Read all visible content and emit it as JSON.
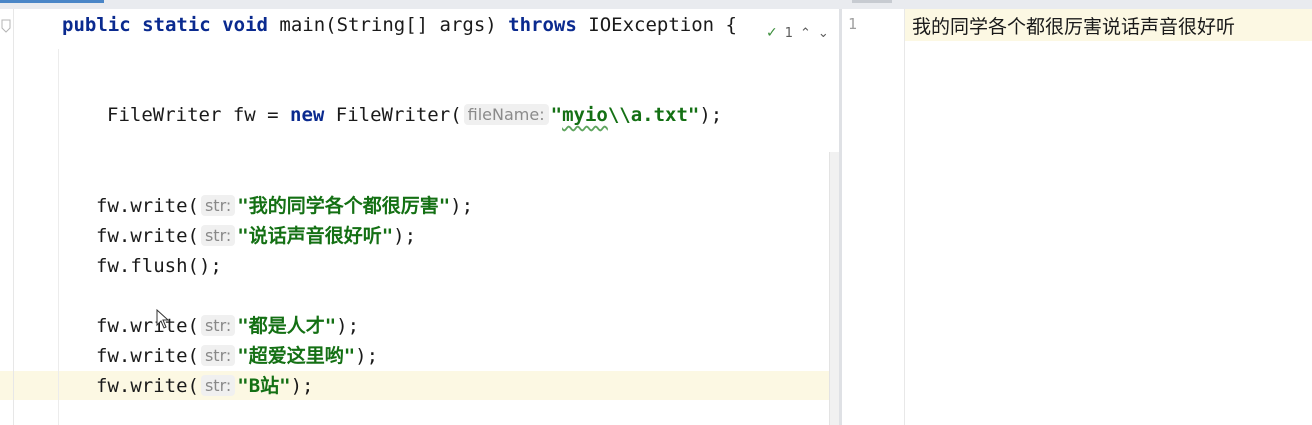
{
  "editor": {
    "inspection": {
      "check_icon": "check-icon",
      "warnings_count": "1",
      "prev_icon": "chevron-up-icon",
      "next_icon": "chevron-down-icon"
    },
    "lines": [
      {
        "parts": [
          {
            "t": "kw",
            "v": "public"
          },
          {
            "t": "plain",
            "v": " "
          },
          {
            "t": "kw",
            "v": "static"
          },
          {
            "t": "plain",
            "v": " "
          },
          {
            "t": "kw",
            "v": "void"
          },
          {
            "t": "plain",
            "v": " main(String[] args) "
          },
          {
            "t": "kw",
            "v": "throws"
          },
          {
            "t": "plain",
            "v": " IOException {"
          }
        ]
      },
      {
        "parts": [
          {
            "t": "plain",
            "v": "FileWriter fw = "
          },
          {
            "t": "kw",
            "v": "new"
          },
          {
            "t": "plain",
            "v": " FileWriter("
          },
          {
            "t": "hint",
            "v": "fileName:"
          },
          {
            "t": "str",
            "v": "\"myio\\\\a.txt\""
          },
          {
            "t": "plain",
            "v": ");"
          }
        ]
      },
      {
        "parts": [
          {
            "t": "plain",
            "v": "fw.write("
          },
          {
            "t": "hint",
            "v": "str:"
          },
          {
            "t": "str",
            "v": "\"我的同学各个都很厉害\""
          },
          {
            "t": "plain",
            "v": ");"
          }
        ]
      },
      {
        "parts": [
          {
            "t": "plain",
            "v": "fw.write("
          },
          {
            "t": "hint",
            "v": "str:"
          },
          {
            "t": "str",
            "v": "\"说话声音很好听\""
          },
          {
            "t": "plain",
            "v": ");"
          }
        ]
      },
      {
        "parts": [
          {
            "t": "plain",
            "v": "fw.flush();"
          }
        ]
      },
      {
        "parts": [
          {
            "t": "plain",
            "v": "fw.write("
          },
          {
            "t": "hint",
            "v": "str:"
          },
          {
            "t": "str",
            "v": "\"都是人才\""
          },
          {
            "t": "plain",
            "v": ");"
          }
        ]
      },
      {
        "parts": [
          {
            "t": "plain",
            "v": "fw.write("
          },
          {
            "t": "hint",
            "v": "str:"
          },
          {
            "t": "str",
            "v": "\"超爱这里哟\""
          },
          {
            "t": "plain",
            "v": ");"
          }
        ]
      },
      {
        "parts": [
          {
            "t": "plain",
            "v": "fw.write("
          },
          {
            "t": "hint",
            "v": "str:"
          },
          {
            "t": "str",
            "v": "\"B站\""
          },
          {
            "t": "plain",
            "v": ");"
          }
        ]
      }
    ]
  },
  "text_file": {
    "line_number": "1",
    "content": "我的同学各个都很厉害说话声音很好听"
  }
}
